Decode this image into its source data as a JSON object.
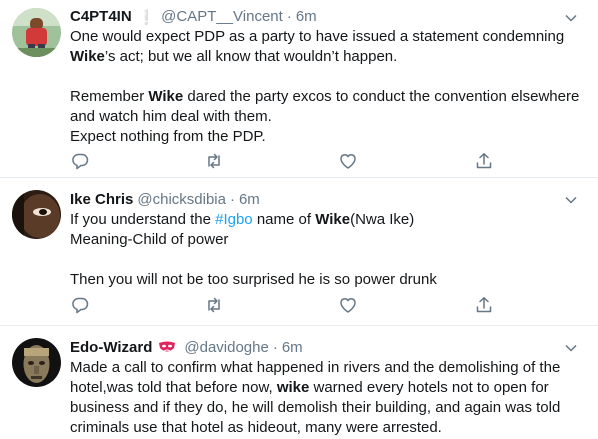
{
  "tweets": [
    {
      "name": "C4PT4IN",
      "separator": "❕",
      "handle": "@CAPT__Vincent",
      "dot": "·",
      "time": "6m",
      "lines": [
        [
          "One would expect PDP as a party to have issued a statement condemning"
        ],
        [
          "",
          "Wike",
          "’s act; but we all know that wouldn’t happen."
        ],
        [],
        [
          "Remember ",
          "Wike",
          " dared the party excos to conduct the convention elsewhere"
        ],
        [
          "and watch him deal with them."
        ],
        [
          "Expect nothing from the PDP."
        ]
      ]
    },
    {
      "name": "Ike Chris",
      "handle": "@chicksdibia",
      "dot": "·",
      "time": "6m",
      "line1_pre": "If you understand the ",
      "hashtag": "#Igbo",
      "line1_mid": " name of ",
      "line1_bold": "Wike",
      "line1_post": "(Nwa Ike)",
      "line2": "Meaning-Child of power",
      "line3": "Then you will not be too surprised he is so power drunk"
    },
    {
      "name": "Edo-Wizard",
      "badge": "mask-emoji",
      "handle": "@davidoghe",
      "dot": "·",
      "time": "6m",
      "line1": "Made a call to confirm what happened in rivers and the demolishing of the",
      "line2": "hotel,was told that before now, ",
      "line2_bold": "wike",
      "line2_post": " warned every hotels not to open for",
      "line3": "business and if they do, he will demolish their building, and again was told",
      "line4": "criminals use that hotel as hideout, many were arrested."
    }
  ],
  "icons": [
    "chevron-down-icon",
    "reply-icon",
    "retweet-icon",
    "like-icon",
    "share-icon"
  ],
  "colors": {
    "name": "#14171a",
    "muted": "#657786",
    "link": "#1da1f2",
    "divider": "#e6ecf0"
  }
}
